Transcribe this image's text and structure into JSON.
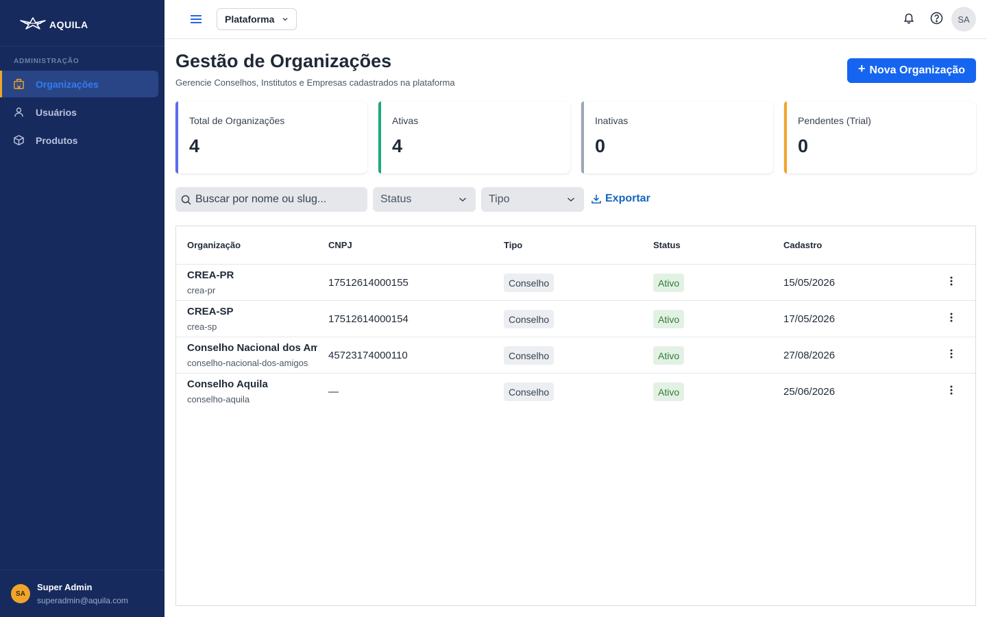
{
  "brand": {
    "name": "AQUILA"
  },
  "sidebar": {
    "section": "ADMINISTRAÇÃO",
    "items": [
      {
        "label": "Organizações",
        "icon": "building-icon",
        "active": true
      },
      {
        "label": "Usuários",
        "icon": "user-icon",
        "active": false
      },
      {
        "label": "Produtos",
        "icon": "box-icon",
        "active": false
      }
    ],
    "user": {
      "initials": "SA",
      "name": "Super Admin",
      "email": "superadmin@aquila.com"
    }
  },
  "topbar": {
    "platform": "Plataforma",
    "avatar": "SA"
  },
  "page": {
    "title": "Gestão de Organizações",
    "subtitle": "Gerencie Conselhos, Institutos e Empresas cadastrados na plataforma",
    "new_button": "Nova Organização"
  },
  "stats": [
    {
      "label": "Total de Organizações",
      "value": "4",
      "color": "#5b6cf0"
    },
    {
      "label": "Ativas",
      "value": "4",
      "color": "#1fa97a"
    },
    {
      "label": "Inativas",
      "value": "0",
      "color": "#9aa6b8"
    },
    {
      "label": "Pendentes (Trial)",
      "value": "0",
      "color": "#f0a52a"
    }
  ],
  "filters": {
    "search_placeholder": "Buscar por nome ou slug...",
    "status": "Status",
    "tipo": "Tipo",
    "export": "Exportar"
  },
  "table": {
    "columns": [
      "Organização",
      "CNPJ",
      "Tipo",
      "Status",
      "Cadastro"
    ],
    "rows": [
      {
        "name": "CREA-PR",
        "slug": "crea-pr",
        "cnpj": "17512614000155",
        "tipo": "Conselho",
        "status": "Ativo",
        "date": "15/05/2026"
      },
      {
        "name": "CREA-SP",
        "slug": "crea-sp",
        "cnpj": "17512614000154",
        "tipo": "Conselho",
        "status": "Ativo",
        "date": "17/05/2026"
      },
      {
        "name": "Conselho Nacional dos Amigos",
        "slug": "conselho-nacional-dos-amigos",
        "cnpj": "45723174000110",
        "tipo": "Conselho",
        "status": "Ativo",
        "date": "27/08/2026"
      },
      {
        "name": "Conselho Aquila",
        "slug": "conselho-aquila",
        "cnpj": "—",
        "tipo": "Conselho",
        "status": "Ativo",
        "date": "25/06/2026"
      }
    ]
  },
  "colors": {
    "sidebar": "#172a5e",
    "primary": "#1565f0",
    "accent": "#f0a52a"
  }
}
